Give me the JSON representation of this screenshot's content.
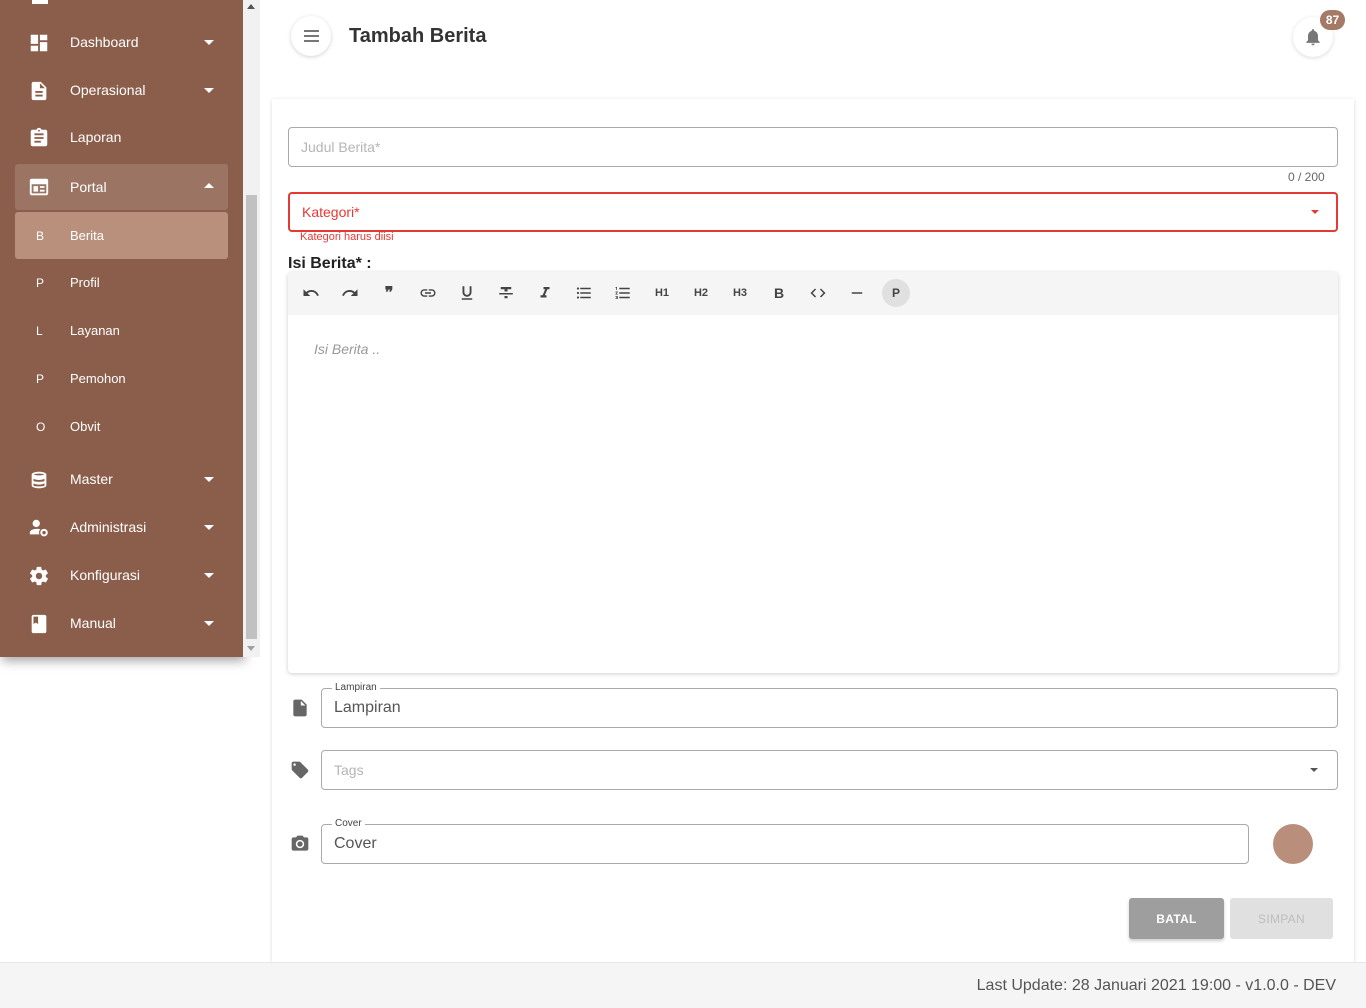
{
  "header": {
    "title": "Tambah Berita",
    "notification_count": "87"
  },
  "sidebar": {
    "items": [
      {
        "label": "Dashboard",
        "icon": "dashboard-icon"
      },
      {
        "label": "Operasional",
        "icon": "document-icon"
      },
      {
        "label": "Laporan",
        "icon": "clipboard-icon"
      },
      {
        "label": "Portal",
        "icon": "portal-icon"
      },
      {
        "label": "Master",
        "icon": "database-icon"
      },
      {
        "label": "Administrasi",
        "icon": "user-settings-icon"
      },
      {
        "label": "Konfigurasi",
        "icon": "gear-icon"
      },
      {
        "label": "Manual",
        "icon": "book-icon"
      }
    ],
    "portal_sub": [
      {
        "letter": "B",
        "label": "Berita"
      },
      {
        "letter": "P",
        "label": "Profil"
      },
      {
        "letter": "L",
        "label": "Layanan"
      },
      {
        "letter": "P",
        "label": "Pemohon"
      },
      {
        "letter": "O",
        "label": "Obvit"
      }
    ]
  },
  "form": {
    "judul_placeholder": "Judul Berita*",
    "judul_counter": "0 / 200",
    "kategori_placeholder": "Kategori*",
    "kategori_error": "Kategori harus diisi",
    "isi_label": "Isi Berita* :",
    "isi_placeholder": "Isi Berita ..",
    "toolbar": {
      "h1": "H1",
      "h2": "H2",
      "h3": "H3",
      "bold": "B",
      "paragraph": "P"
    },
    "lampiran_legend": "Lampiran",
    "lampiran_value": "Lampiran",
    "tags_placeholder": "Tags",
    "cover_legend": "Cover",
    "cover_value": "Cover",
    "batal_label": "BATAL",
    "simpan_label": "SIMPAN"
  },
  "footer": {
    "text": "Last Update: 28 Januari 2021 19:00 - v1.0.0 - DEV"
  },
  "colors": {
    "sidebar": "#8a5e4a",
    "active": "#b8907c",
    "error": "#e53935",
    "badge": "#a47a67"
  }
}
